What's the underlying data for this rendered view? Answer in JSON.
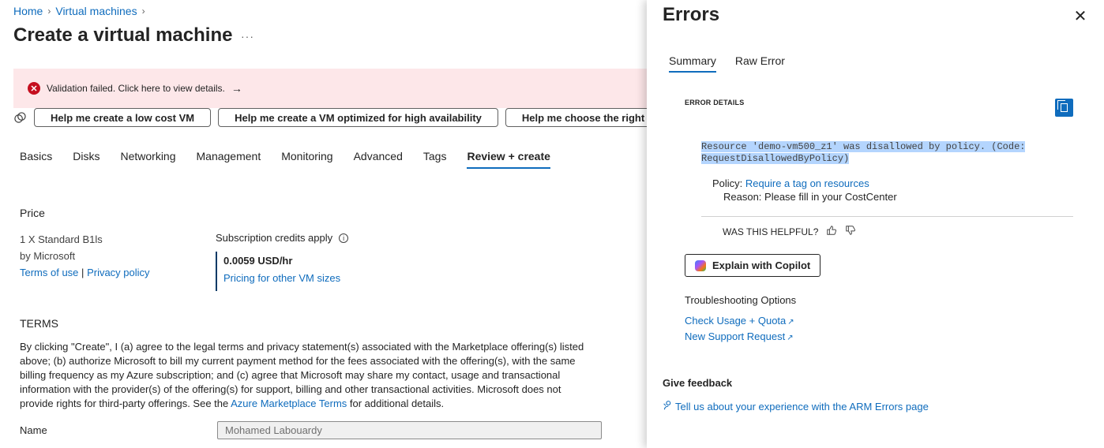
{
  "breadcrumb": {
    "home": "Home",
    "vms": "Virtual machines",
    "sep": "›"
  },
  "page": {
    "title": "Create a virtual machine",
    "more": "···"
  },
  "banner": {
    "icon": "✕",
    "text": "Validation failed. Click here to view details.",
    "arrow": "→"
  },
  "help_buttons": [
    "Help me create a low cost VM",
    "Help me create a VM optimized for high availability",
    "Help me choose the right VM"
  ],
  "tabs": [
    "Basics",
    "Disks",
    "Networking",
    "Management",
    "Monitoring",
    "Advanced",
    "Tags",
    "Review + create"
  ],
  "price": {
    "heading": "Price",
    "vm_name": "1 X Standard B1ls",
    "by": "by Microsoft",
    "terms_link": "Terms of use",
    "divider": "|",
    "privacy_link": "Privacy policy",
    "credits": "Subscription credits apply",
    "amount": "0.0059 USD/hr",
    "other_sizes_link": "Pricing for other VM sizes"
  },
  "terms": {
    "heading": "TERMS",
    "body_before": "By clicking \"Create\", I (a) agree to the legal terms and privacy statement(s) associated with the Marketplace offering(s) listed above; (b) authorize Microsoft to bill my current payment method for the fees associated with the offering(s), with the same billing frequency as my Azure subscription; and (c) agree that Microsoft may share my contact, usage and transactional information with the provider(s) of the offering(s) for support, billing and other transactional activities. Microsoft does not provide rights for third-party offerings. See the ",
    "link": "Azure Marketplace Terms",
    "body_after": " for additional details."
  },
  "name_field": {
    "label": "Name",
    "value": "Mohamed Labouardy"
  },
  "panel": {
    "title": "Errors",
    "close": "✕",
    "tabs": [
      "Summary",
      "Raw Error"
    ],
    "error_details_label": "ERROR DETAILS",
    "error_message": "Resource 'demo-vm500_z1' was disallowed by policy. (Code: RequestDisallowedByPolicy)",
    "policy_label": "Policy: ",
    "policy_link": "Require a tag on resources",
    "reason": "Reason: Please fill in your CostCenter",
    "helpful": "WAS THIS HELPFUL?",
    "copilot_button": "Explain with Copilot",
    "troubleshooting": "Troubleshooting Options",
    "links": [
      "Check Usage + Quota",
      "New Support Request"
    ],
    "feedback_title": "Give feedback",
    "feedback_link": "Tell us about your experience with the ARM Errors page"
  },
  "icons": {
    "error": "error-circle-icon",
    "help": "assistant-icon",
    "info": "info-icon",
    "copy": "copy-icon",
    "close": "close-icon",
    "thumbs_up": "thumbs-up-icon",
    "thumbs_down": "thumbs-down-icon",
    "external": "external-link-icon",
    "feedback": "person-feedback-icon"
  },
  "colors": {
    "accent": "#0f6cbd",
    "error": "#c50f1f",
    "banner_bg": "#fde7e9",
    "highlight": "#b4d5fe"
  }
}
